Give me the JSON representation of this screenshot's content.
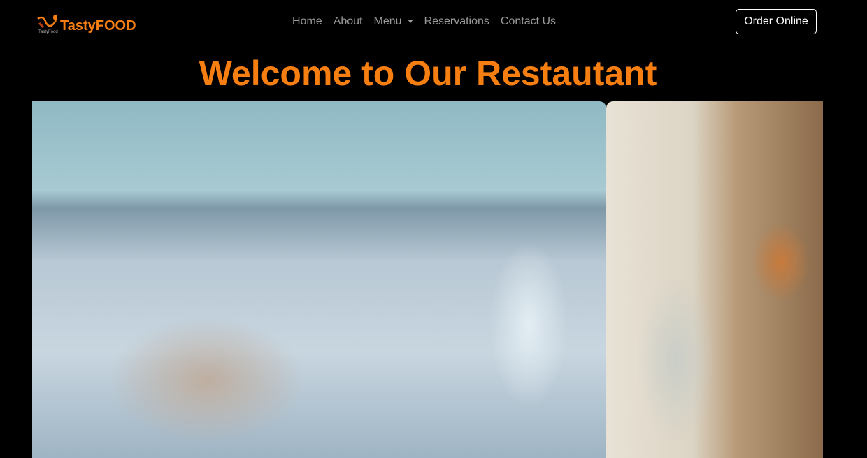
{
  "brand": {
    "name": "TastyFOOD",
    "logo_text": "TastyFood"
  },
  "nav": {
    "items": [
      "Home",
      "About",
      "Menu",
      "Reservations",
      "Contact Us"
    ],
    "order_label": "Order Online"
  },
  "hero": {
    "title": "Welcome to Our Restautant"
  },
  "colors": {
    "accent": "#f77f11"
  }
}
